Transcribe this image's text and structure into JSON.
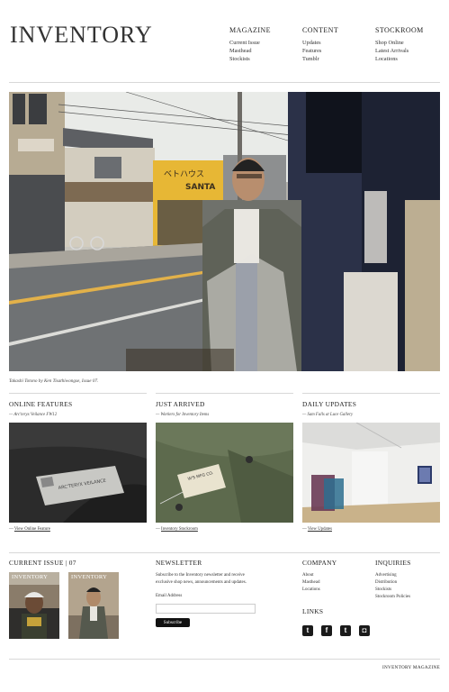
{
  "header": {
    "logo": "INVENTORY",
    "nav": [
      {
        "heading": "MAGAZINE",
        "links": [
          "Current Issue",
          "Masthead",
          "Stockists"
        ]
      },
      {
        "heading": "CONTENT",
        "links": [
          "Updates",
          "Features",
          "Tumblr"
        ]
      },
      {
        "heading": "STOCKROOM",
        "links": [
          "Shop Online",
          "Latest Arrivals",
          "Locations"
        ]
      }
    ]
  },
  "hero": {
    "caption": "Takashi Totono by Ken Tisathiwongse, Issue 07.",
    "sign_shop": "SANTA",
    "sign_kanji": "ベトハウス"
  },
  "sections": [
    {
      "title": "ONLINE FEATURES",
      "subtitle": "— Arc'teryx Veilance FW12",
      "link_prefix": "— ",
      "link": "View Online Feature",
      "label_text": "ARC'TERYX VEILANCE"
    },
    {
      "title": "JUST ARRIVED",
      "subtitle": "— Workers for Inventory Items",
      "link_prefix": "— ",
      "link": "Inventory Stockroom",
      "tag_text": "W'S MFG CO."
    },
    {
      "title": "DAILY UPDATES",
      "subtitle": "— Sam Falls at Luce Gallery",
      "link_prefix": "— ",
      "link": "View Updates"
    }
  ],
  "bottom": {
    "issue": {
      "title": "CURRENT ISSUE | 07",
      "cover_label": "INVENTORY"
    },
    "newsletter": {
      "title": "NEWSLETTER",
      "text": "Subscribe to the Inventory newsletter and receive exclusive shop news, announcements and updates.",
      "email_label": "Email Address",
      "email_value": "",
      "button": "Subscribe"
    },
    "company": {
      "title": "COMPANY",
      "links": [
        "About",
        "Masthead",
        "Locations"
      ]
    },
    "inquiries": {
      "title": "INQUIRIES",
      "links": [
        "Advertising",
        "Distribution",
        "Stockists",
        "Stockroom Policies"
      ]
    },
    "links": {
      "title": "LINKS",
      "social": [
        {
          "icon": "tumblr-icon",
          "glyph": "t"
        },
        {
          "icon": "facebook-icon",
          "glyph": "f"
        },
        {
          "icon": "twitter-icon",
          "glyph": "t"
        },
        {
          "icon": "instagram-icon",
          "glyph": "◘"
        }
      ]
    }
  },
  "footer": {
    "text": "INVENTORY MAGAZINE"
  }
}
